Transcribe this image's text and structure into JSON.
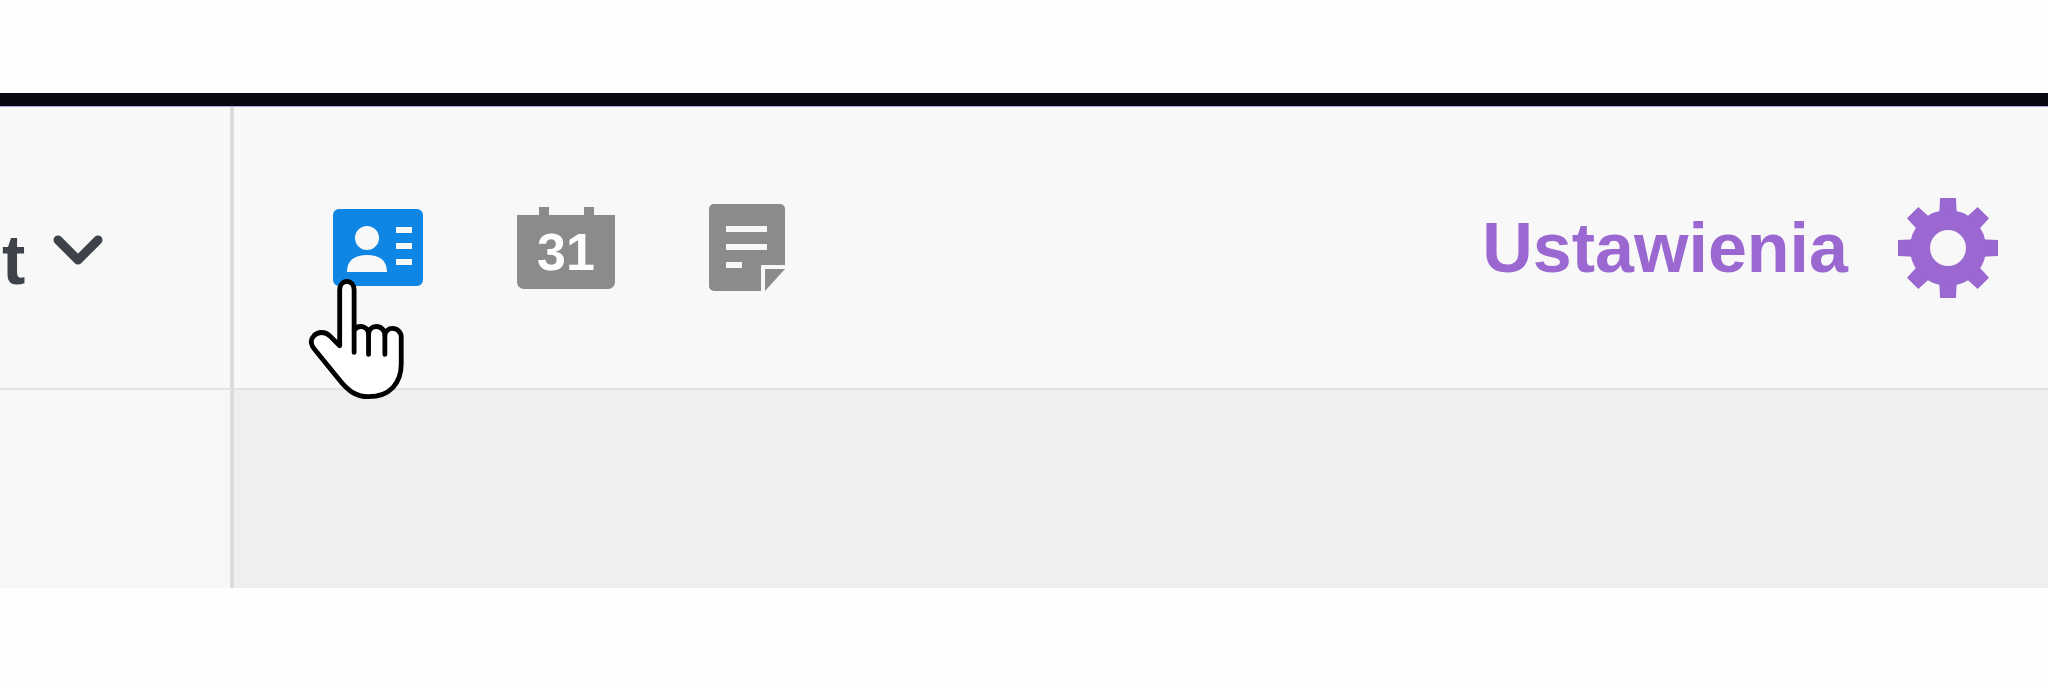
{
  "sidebar": {
    "dropdown": {
      "label": "t"
    }
  },
  "toolbar": {
    "apps": [
      {
        "kind": "contacts",
        "selected": true
      },
      {
        "kind": "calendar",
        "label": "31",
        "selected": false
      },
      {
        "kind": "notes",
        "selected": false
      }
    ],
    "settings": {
      "label": "Ustawienia"
    }
  }
}
